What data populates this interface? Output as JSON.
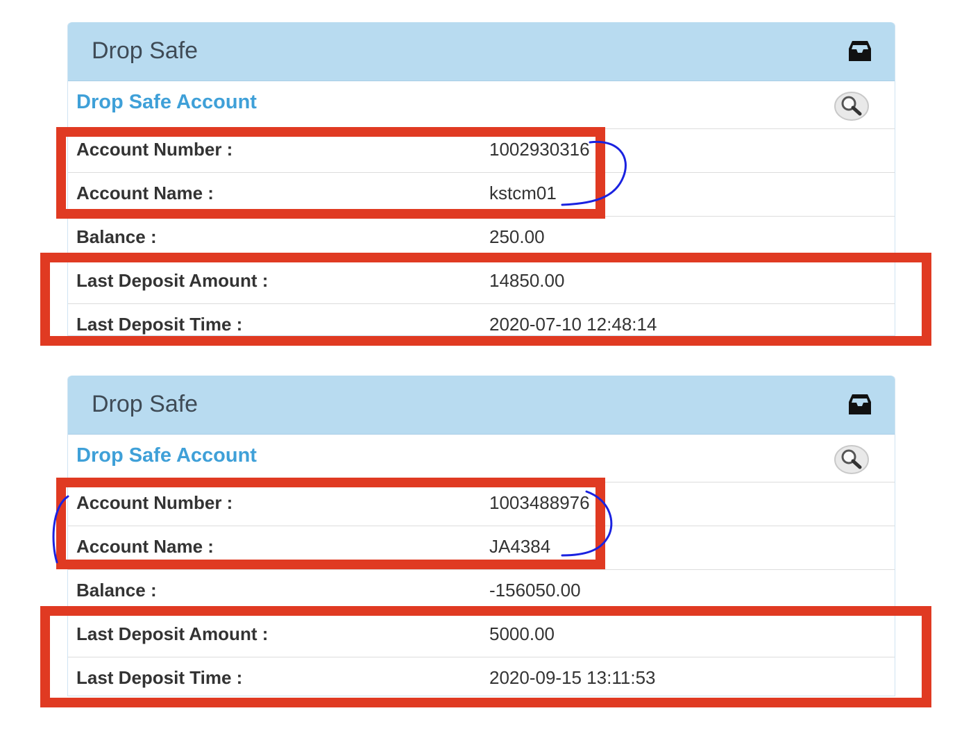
{
  "panels": [
    {
      "title": "Drop Safe",
      "subtitle": "Drop Safe Account",
      "rows": [
        {
          "label": "Account Number :",
          "value": "1002930316"
        },
        {
          "label": "Account Name :",
          "value": "kstcm01"
        },
        {
          "label": "Balance :",
          "value": "250.00"
        },
        {
          "label": "Last Deposit Amount :",
          "value": "14850.00"
        },
        {
          "label": "Last Deposit Time :",
          "value": "2020-07-10 12:48:14"
        }
      ]
    },
    {
      "title": "Drop Safe",
      "subtitle": "Drop Safe Account",
      "rows": [
        {
          "label": "Account Number :",
          "value": "1003488976"
        },
        {
          "label": "Account Name :",
          "value": "JA4384"
        },
        {
          "label": "Balance :",
          "value": "-156050.00"
        },
        {
          "label": "Last Deposit Amount :",
          "value": "5000.00"
        },
        {
          "label": "Last Deposit Time :",
          "value": "2020-09-15 13:11:53"
        }
      ]
    }
  ],
  "icons": {
    "header": "inbox-icon",
    "subhead": "search-icon"
  },
  "colors": {
    "header_bg": "#b8dbf0",
    "subtitle": "#3fa0d8",
    "annotation_red": "#e03a22",
    "annotation_blue": "#1a22e0"
  }
}
